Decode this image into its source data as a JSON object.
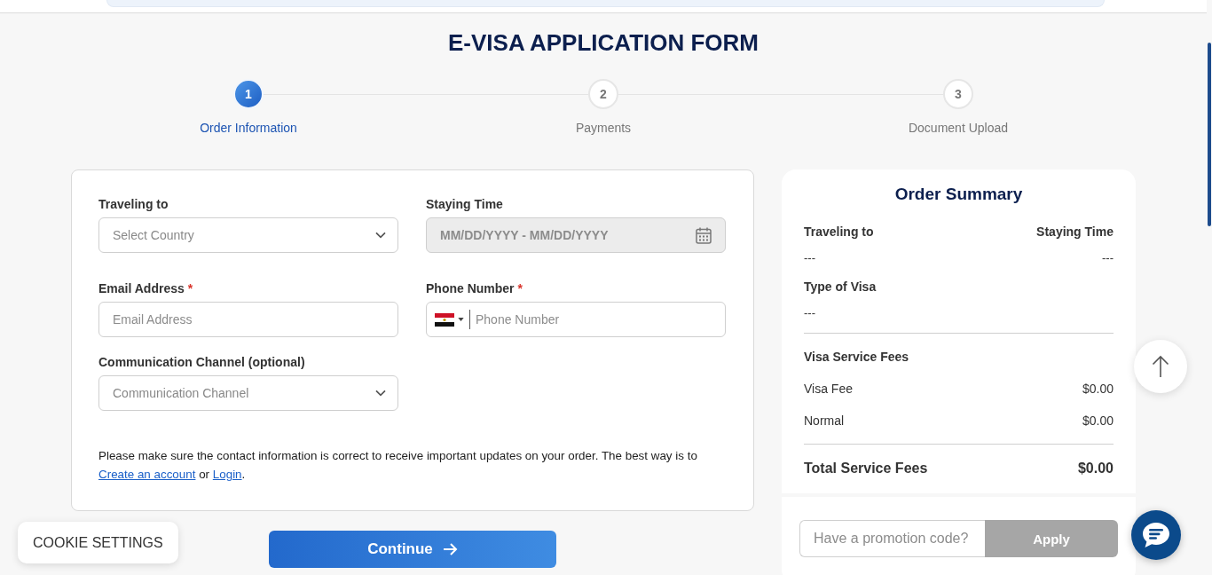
{
  "title": "E-VISA APPLICATION FORM",
  "steps": [
    {
      "number": "1",
      "label": "Order Information",
      "selected": true
    },
    {
      "number": "2",
      "label": "Payments",
      "selected": false
    },
    {
      "number": "3",
      "label": "Document Upload",
      "selected": false
    }
  ],
  "form": {
    "fields": [
      {
        "kind": "select",
        "label": "Traveling to",
        "placeholder": "Select Country",
        "disabled": false
      },
      {
        "kind": "date",
        "label": "Staying Time",
        "placeholder": "MM/DD/YYYY - MM/DD/YYYY",
        "disabled": true
      },
      {
        "kind": "text",
        "label": "Email Address",
        "required_mark": "*",
        "placeholder": "Email Address",
        "disabled": false
      },
      {
        "kind": "phone",
        "label": "Phone Number",
        "required_mark": "*",
        "placeholder": "Phone Number",
        "disabled": false
      },
      {
        "kind": "select",
        "label": "Communication Channel (optional)",
        "placeholder": "Communication Channel",
        "disabled": false
      }
    ],
    "note": [
      {
        "kind": "text",
        "text": "Please make sure the contact information is correct to receive important updates on your order. The best way is to "
      },
      {
        "kind": "link",
        "text": "Create an account"
      },
      {
        "kind": "text",
        "text": " or "
      },
      {
        "kind": "link",
        "text": "Login"
      },
      {
        "kind": "text",
        "text": "."
      }
    ]
  },
  "continue_button": {
    "label": "Continue"
  },
  "summary": {
    "title": "Order Summary",
    "trip_rows": [
      [
        {
          "label": "Traveling to",
          "value": "---"
        },
        {
          "label": "Staying Time",
          "value": "---"
        }
      ],
      [
        {
          "label": "Type of Visa",
          "value": "---"
        }
      ]
    ],
    "fees": {
      "heading": "Visa Service Fees",
      "items": [
        {
          "label": "Visa Fee",
          "amount": "$0.00"
        },
        {
          "label": "Normal",
          "amount": "$0.00"
        }
      ],
      "total": {
        "label": "Total Service Fees",
        "amount": "$0.00"
      }
    },
    "promo": {
      "placeholder": "Have a promotion code?",
      "button": "Apply",
      "disabled": true
    }
  },
  "cookie_button": {
    "label": "COOKIE SETTINGS"
  }
}
